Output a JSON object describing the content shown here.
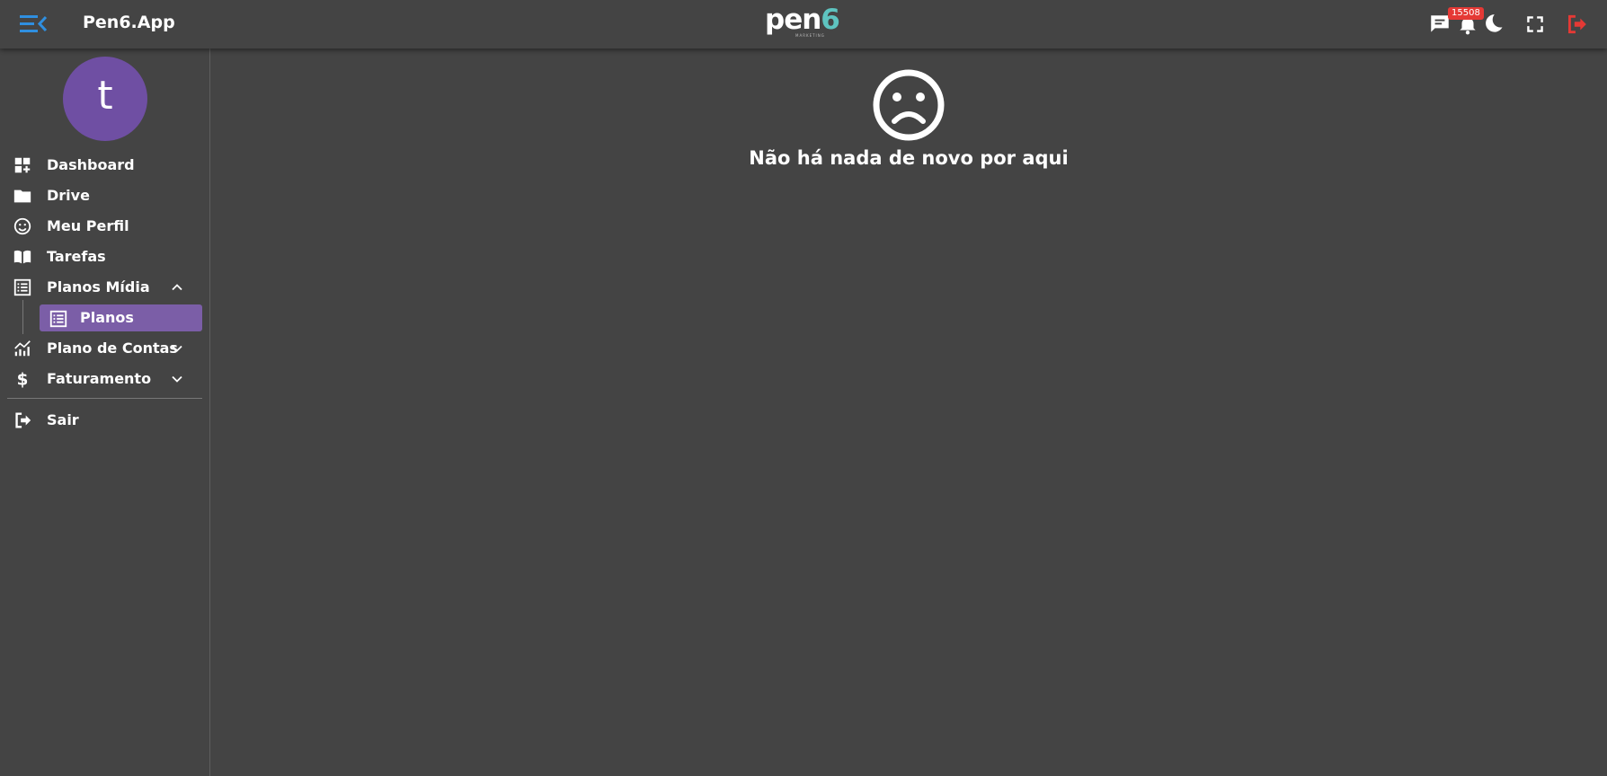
{
  "header": {
    "app_title": "Pen6.App",
    "logo_text": "pen6",
    "logo_subtext": "MARKETING",
    "notifications_count": "15508",
    "icons": [
      "menu-toggle-icon",
      "chat-icon",
      "bell-icon",
      "theme-icon",
      "fullscreen-icon",
      "logout-icon"
    ]
  },
  "sidebar": {
    "avatar_letter": "t",
    "items": [
      {
        "label": "Dashboard",
        "icon": "dashboard-icon"
      },
      {
        "label": "Drive",
        "icon": "folder-icon"
      },
      {
        "label": "Meu Perfil",
        "icon": "smiley-icon"
      },
      {
        "label": "Tarefas",
        "icon": "book-icon"
      },
      {
        "label": "Planos Mídia",
        "icon": "list-icon",
        "expanded": true
      },
      {
        "label": "Plano de Contas",
        "icon": "chart-icon",
        "expanded": false
      },
      {
        "label": "Faturamento",
        "icon": "dollar-icon",
        "expanded": false
      }
    ],
    "sub_items": [
      {
        "label": "Planos",
        "icon": "list-icon",
        "active": true
      }
    ],
    "logout_label": "Sair"
  },
  "main": {
    "empty_message": "Não há nada de novo por aqui",
    "empty_icon": "sad-face-icon"
  },
  "colors": {
    "background": "#444444",
    "accent_blue": "#2f8fe0",
    "avatar": "#6f4fa3",
    "active_item": "#7b5ea7",
    "logout_red": "#e53935",
    "logo_teal": "#5ec4c0"
  }
}
